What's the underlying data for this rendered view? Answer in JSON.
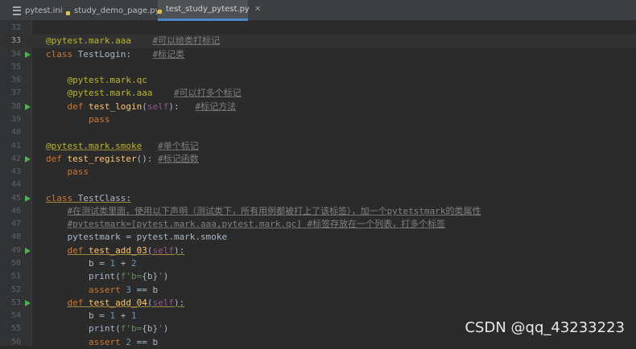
{
  "tabs": [
    {
      "label": "pytest.ini",
      "icon": "ini-file-icon",
      "active": false
    },
    {
      "label": "study_demo_page.py",
      "icon": "python-file-icon",
      "active": false
    },
    {
      "label": "test_study_pytest.py",
      "icon": "python-file-icon",
      "active": true
    }
  ],
  "lines": [
    {
      "n": "32",
      "run": false,
      "segs": []
    },
    {
      "n": "33",
      "run": false,
      "current": true,
      "segs": [
        {
          "t": "@pytest.mark.aaa",
          "c": "deco"
        },
        {
          "t": "    "
        },
        {
          "t": "#可以给类打标记",
          "c": "cmt"
        }
      ]
    },
    {
      "n": "34",
      "run": true,
      "segs": [
        {
          "t": "class ",
          "c": "kw"
        },
        {
          "t": "TestLogin:"
        },
        {
          "t": "    "
        },
        {
          "t": "#标记类",
          "c": "cmt"
        }
      ]
    },
    {
      "n": "35",
      "run": false,
      "segs": []
    },
    {
      "n": "36",
      "run": false,
      "segs": [
        {
          "t": "    "
        },
        {
          "t": "@pytest.mark.qc",
          "c": "deco"
        }
      ]
    },
    {
      "n": "37",
      "run": false,
      "segs": [
        {
          "t": "    "
        },
        {
          "t": "@pytest.mark.aaa",
          "c": "deco"
        },
        {
          "t": "    "
        },
        {
          "t": "#可以打多个标记",
          "c": "cmt"
        }
      ]
    },
    {
      "n": "38",
      "run": true,
      "segs": [
        {
          "t": "    "
        },
        {
          "t": "def ",
          "c": "kw"
        },
        {
          "t": "test_login",
          "c": "fn"
        },
        {
          "t": "("
        },
        {
          "t": "self",
          "c": "slf"
        },
        {
          "t": "):   "
        },
        {
          "t": "#标记方法",
          "c": "cmt"
        }
      ]
    },
    {
      "n": "39",
      "run": false,
      "segs": [
        {
          "t": "        "
        },
        {
          "t": "pass",
          "c": "kw"
        }
      ]
    },
    {
      "n": "40",
      "run": false,
      "segs": []
    },
    {
      "n": "41",
      "run": false,
      "segs": [
        {
          "t": "@pytest.mark.smoke",
          "c": "deco und"
        },
        {
          "t": "   "
        },
        {
          "t": "#单个标记",
          "c": "cmt"
        }
      ]
    },
    {
      "n": "42",
      "run": true,
      "segs": [
        {
          "t": "def ",
          "c": "kw"
        },
        {
          "t": "test_register",
          "c": "fn"
        },
        {
          "t": "(): "
        },
        {
          "t": "#标记函数",
          "c": "cmt"
        }
      ]
    },
    {
      "n": "43",
      "run": false,
      "segs": [
        {
          "t": "    "
        },
        {
          "t": "pass",
          "c": "kw"
        }
      ]
    },
    {
      "n": "44",
      "run": false,
      "segs": []
    },
    {
      "n": "45",
      "run": true,
      "segs": [
        {
          "t": "class ",
          "c": "kw und"
        },
        {
          "t": "TestClass:",
          "c": "und"
        }
      ]
    },
    {
      "n": "46",
      "run": false,
      "segs": [
        {
          "t": "    "
        },
        {
          "t": "#在测试类里面，使用以下声明（测试类下，所有用例都被打上了该标签），加一个pytetstmark的类属性",
          "c": "cmt"
        }
      ]
    },
    {
      "n": "47",
      "run": false,
      "segs": [
        {
          "t": "    "
        },
        {
          "t": "#pytestmark=[pytest.mark.aaa,pytest.mark.qc] #标签存放在一个列表，打多个标签",
          "c": "cmt"
        }
      ]
    },
    {
      "n": "48",
      "run": false,
      "segs": [
        {
          "t": "    pytestmark = pytest.mark.smoke"
        }
      ]
    },
    {
      "n": "49",
      "run": true,
      "segs": [
        {
          "t": "    "
        },
        {
          "t": "def ",
          "c": "kw und"
        },
        {
          "t": "test_add_03",
          "c": "fn und"
        },
        {
          "t": "(",
          "c": "und"
        },
        {
          "t": "self",
          "c": "slf und"
        },
        {
          "t": "):",
          "c": "und"
        }
      ]
    },
    {
      "n": "50",
      "run": false,
      "segs": [
        {
          "t": "        b = "
        },
        {
          "t": "1",
          "c": "num"
        },
        {
          "t": " + "
        },
        {
          "t": "2",
          "c": "num"
        }
      ]
    },
    {
      "n": "51",
      "run": false,
      "segs": [
        {
          "t": "        print("
        },
        {
          "t": "f'b=",
          "c": "str"
        },
        {
          "t": "{b}"
        },
        {
          "t": "'",
          "c": "str"
        },
        {
          "t": ")"
        }
      ]
    },
    {
      "n": "52",
      "run": false,
      "segs": [
        {
          "t": "        "
        },
        {
          "t": "assert ",
          "c": "kw"
        },
        {
          "t": "3",
          "c": "num"
        },
        {
          "t": " == b"
        }
      ]
    },
    {
      "n": "53",
      "run": true,
      "segs": [
        {
          "t": "    "
        },
        {
          "t": "def ",
          "c": "kw und"
        },
        {
          "t": "test_add_04",
          "c": "fn und"
        },
        {
          "t": "(",
          "c": "und"
        },
        {
          "t": "self",
          "c": "slf und"
        },
        {
          "t": "):",
          "c": "und"
        }
      ]
    },
    {
      "n": "54",
      "run": false,
      "segs": [
        {
          "t": "        b = "
        },
        {
          "t": "1",
          "c": "num"
        },
        {
          "t": " + "
        },
        {
          "t": "1",
          "c": "num"
        }
      ]
    },
    {
      "n": "55",
      "run": false,
      "segs": [
        {
          "t": "        print("
        },
        {
          "t": "f'b=",
          "c": "str"
        },
        {
          "t": "{b}"
        },
        {
          "t": "'",
          "c": "str"
        },
        {
          "t": ")"
        }
      ]
    },
    {
      "n": "56",
      "run": false,
      "segs": [
        {
          "t": "        "
        },
        {
          "t": "assert ",
          "c": "kw"
        },
        {
          "t": "2",
          "c": "num"
        },
        {
          "t": " == b"
        }
      ]
    }
  ],
  "watermark": "CSDN @qq_43233223"
}
